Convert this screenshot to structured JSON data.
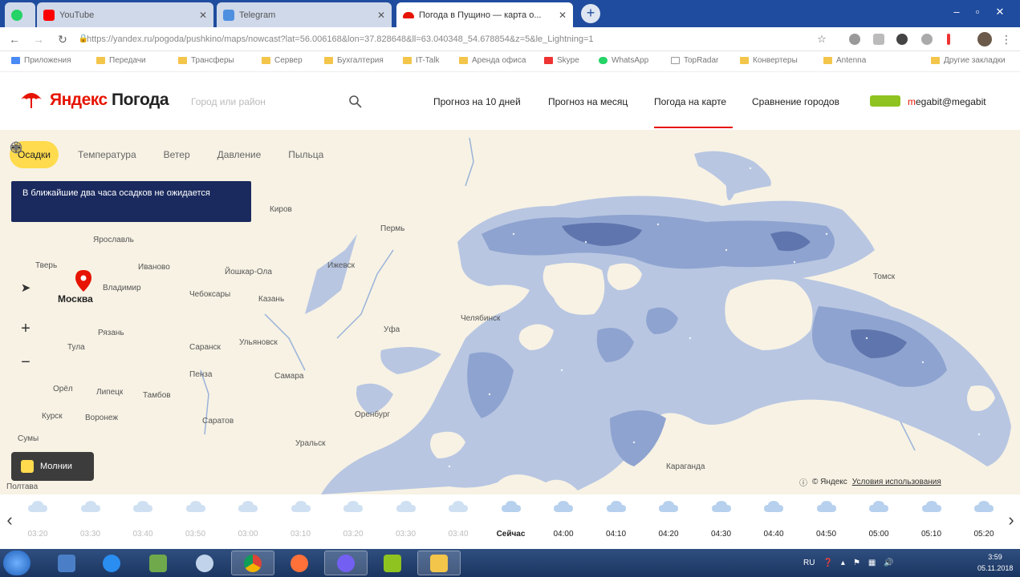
{
  "browser": {
    "tabs": [
      {
        "title": "YouTube",
        "favicon_color": "#ff0000"
      },
      {
        "title": "Telegram",
        "favicon_color": "#4e8fe0"
      },
      {
        "title": "Погода в Пущино — карта о...",
        "favicon_color": "#e61400"
      }
    ],
    "new_tab_label": "+",
    "url": "https://yandex.ru/pogoda/pushkino/maps/nowcast?lat=56.006168&lon=37.828648&ll=63.040348_54.678854&z=5&le_Lightning=1",
    "bookmarks": [
      "Приложения",
      "Передачи",
      "Трансферы",
      "Сервер",
      "Бухгалтерия",
      "IT-Talk",
      "Аренда офиса",
      "Skype",
      "WhatsApp",
      "TopRadar",
      "Конвертеры",
      "Antenna",
      "Другие закладки"
    ]
  },
  "site": {
    "brand_part1": "Яндекс",
    "brand_part2": "Погода",
    "search_placeholder": "Город или район",
    "nav": [
      "Прогноз на 10 дней",
      "Прогноз на месяц",
      "Погода на карте",
      "Сравнение городов"
    ],
    "active_nav_index": 2,
    "user_first": "m",
    "user_rest": "egabit@megabit"
  },
  "map": {
    "layers": [
      {
        "label": "Осадки",
        "icon": "umbrella-cloud-icon",
        "active": true
      },
      {
        "label": "Температура",
        "icon": "thermometer-icon",
        "active": false
      },
      {
        "label": "Ветер",
        "icon": "wind-icon",
        "active": false
      },
      {
        "label": "Давление",
        "icon": "gauge-icon",
        "active": false
      },
      {
        "label": "Пыльца",
        "icon": "pollen-icon",
        "active": false
      }
    ],
    "notice": "В ближайшие два часа осадков не ожидается",
    "cities": [
      "Киров",
      "Пермь",
      "Ярославль",
      "Тверь",
      "Иваново",
      "Москва",
      "Владимир",
      "Йошкар-Ола",
      "Ижевск",
      "Чебоксары",
      "Казань",
      "Рязань",
      "Тула",
      "Ульяновск",
      "Уфа",
      "Челябинск",
      "Саранск",
      "Пенза",
      "Самара",
      "Орёл",
      "Липецк",
      "Тамбов",
      "Курск",
      "Воронеж",
      "Саратов",
      "Оренбург",
      "Сумы",
      "Полтава",
      "Уральск",
      "Томск",
      "Караганда"
    ],
    "legend_label": "Молнии",
    "copyright": "© Яндекс",
    "terms_label": "Условия использования",
    "rain_light": "#b8c6e2",
    "rain_mid": "#8ea3cf",
    "rain_heavy": "#5f75ad"
  },
  "timeline": {
    "past": [
      "03:20",
      "03:30",
      "03:40",
      "03:50",
      "03:00",
      "03:10",
      "03:20",
      "03:30",
      "03:40"
    ],
    "now_label": "Сейчас",
    "future": [
      "04:00",
      "04:10",
      "04:20",
      "04:30",
      "04:40",
      "04:50",
      "05:00",
      "05:10",
      "05:20"
    ]
  },
  "taskbar": {
    "tray_lang": "RU",
    "clock_time": "3:59",
    "clock_date": "05.11.2018"
  }
}
